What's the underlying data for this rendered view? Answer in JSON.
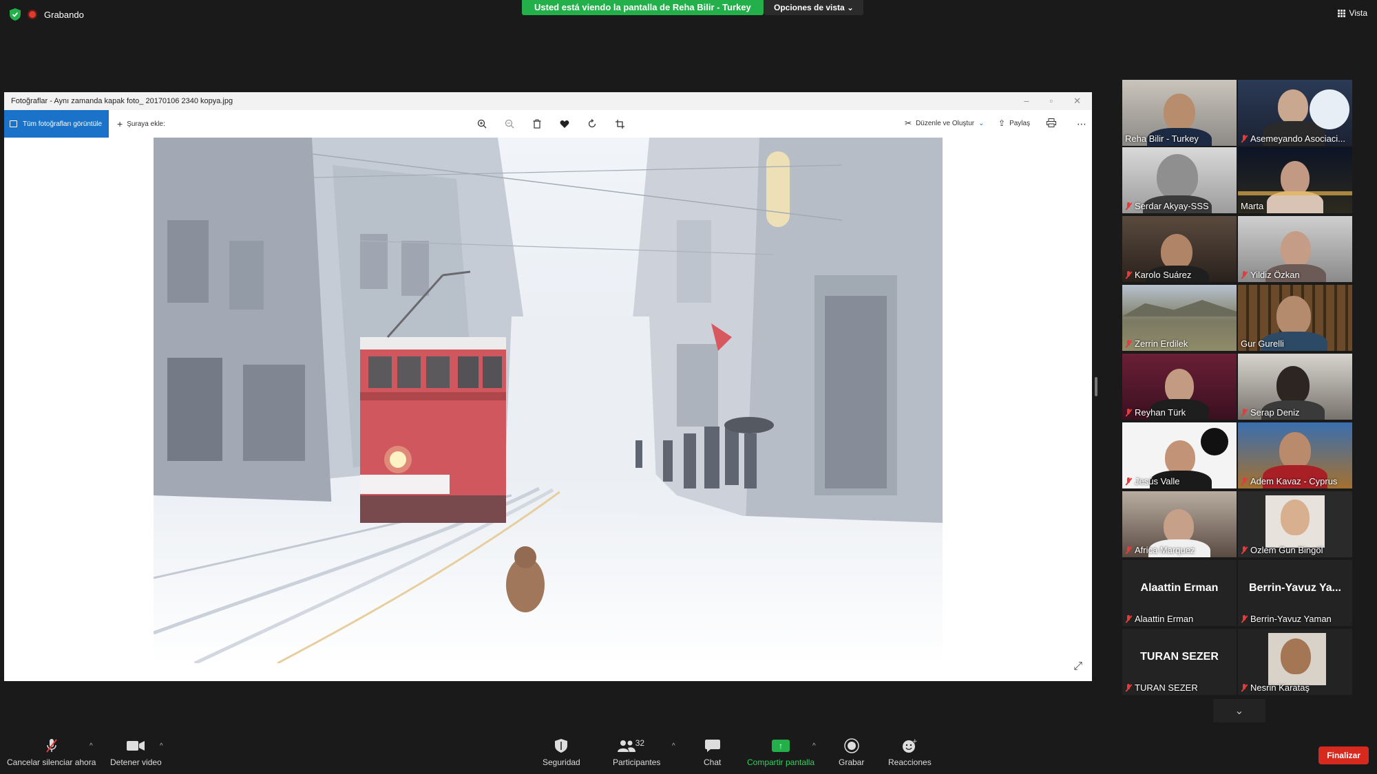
{
  "topbar": {
    "recording_label": "Grabando",
    "banner_text": "Usted está viendo la pantalla de Reha Bilir - Turkey",
    "view_options_label": "Opciones de vista",
    "view_label": "Vista"
  },
  "shared_window": {
    "title": "Fotoğraflar - Aynı zamanda kapak foto_ 20170106 2340 kopya.jpg",
    "all_photos_label": "Tüm fotoğrafları görüntüle",
    "add_to_label": "Şuraya ekle:",
    "edit_create_label": "Düzenle ve Oluştur",
    "share_label": "Paylaş",
    "toolbar_icons": [
      "zoom-in-icon",
      "zoom-out-icon",
      "trash-icon",
      "heart-icon",
      "rotate-icon",
      "crop-icon"
    ]
  },
  "participants": [
    {
      "name": "Reha Bilir - Turkey",
      "muted": false,
      "active": false,
      "video": true
    },
    {
      "name": "Asemeyando Asociaci...",
      "muted": true,
      "active": false,
      "video": true
    },
    {
      "name": "Serdar Akyay-SSS",
      "muted": true,
      "active": false,
      "video": true
    },
    {
      "name": "Marta",
      "muted": false,
      "active": true,
      "video": true
    },
    {
      "name": "Karolo Suárez",
      "muted": true,
      "active": false,
      "video": true
    },
    {
      "name": "Yildiz Özkan",
      "muted": true,
      "active": false,
      "video": true
    },
    {
      "name": "Zerrin Erdilek",
      "muted": true,
      "active": false,
      "video": true
    },
    {
      "name": "Gur Gurelli",
      "muted": false,
      "active": false,
      "video": true
    },
    {
      "name": "Reyhan Türk",
      "muted": true,
      "active": false,
      "video": true
    },
    {
      "name": "Serap Deniz",
      "muted": true,
      "active": false,
      "video": true
    },
    {
      "name": "Jesús Valle",
      "muted": true,
      "active": false,
      "video": true
    },
    {
      "name": "Adem Kavaz - Cyprus",
      "muted": true,
      "active": false,
      "video": true
    },
    {
      "name": "Africa Marquez",
      "muted": true,
      "active": false,
      "video": true
    },
    {
      "name": "Ozlem Gun Bingöl",
      "muted": true,
      "active": false,
      "video": true
    },
    {
      "name": "Alaattin Erman",
      "display": "Alaattin Erman",
      "muted": true,
      "active": false,
      "video": false
    },
    {
      "name": "Berrin-Yavuz Yaman",
      "display": "Berrin-Yavuz Ya...",
      "muted": true,
      "active": false,
      "video": false
    },
    {
      "name": "TURAN SEZER",
      "display": "TURAN SEZER",
      "muted": true,
      "active": false,
      "video": false
    },
    {
      "name": "Nesrin Karataş",
      "muted": true,
      "active": false,
      "video": true
    }
  ],
  "bottombar": {
    "unmute_label": "Cancelar silenciar ahora",
    "stop_video_label": "Detener video",
    "security_label": "Seguridad",
    "participants_label": "Participantes",
    "participants_count": "32",
    "chat_label": "Chat",
    "share_screen_label": "Compartir pantalla",
    "record_label": "Grabar",
    "reactions_label": "Reacciones",
    "end_label": "Finalizar"
  },
  "colors": {
    "banner_green": "#23b04a",
    "active_speaker": "#d6e02b",
    "end_red": "#d8291f",
    "photos_blue": "#1a73c8"
  }
}
